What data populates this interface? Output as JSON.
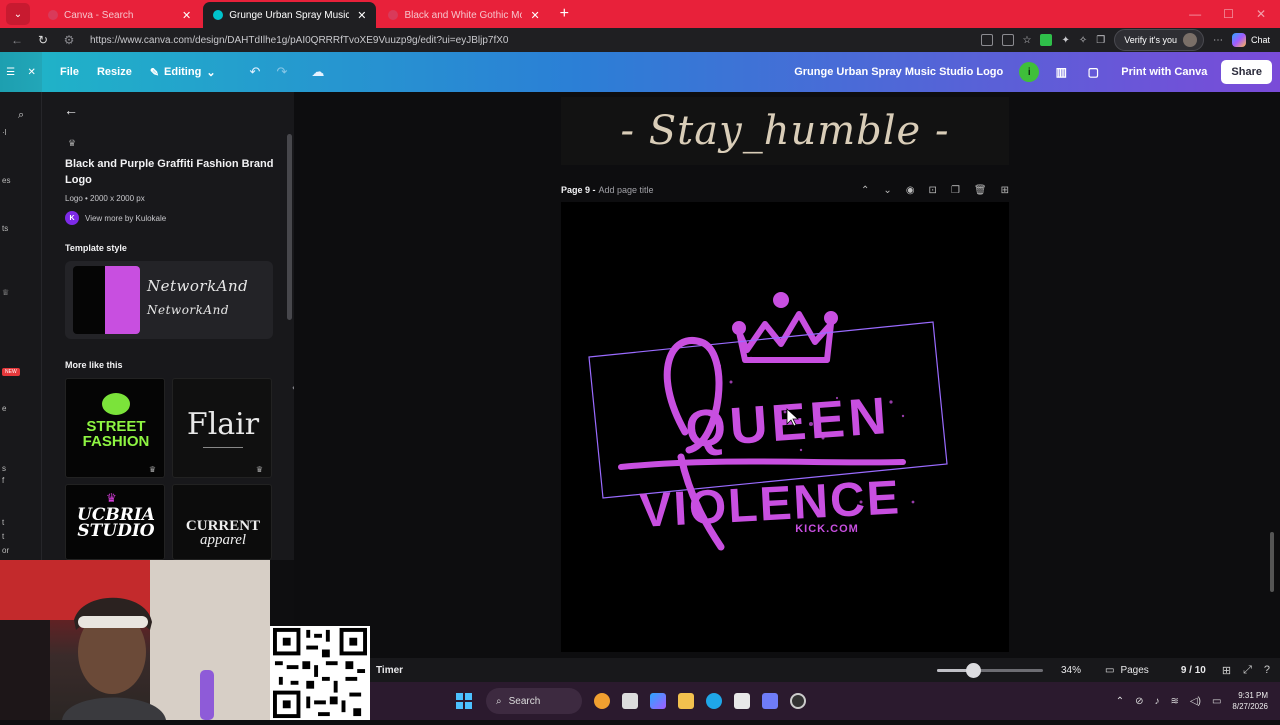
{
  "browser": {
    "tabs": [
      {
        "label": "Canva - Search",
        "active": false
      },
      {
        "label": "Grunge Urban Spray Music Studio",
        "active": true
      },
      {
        "label": "Black and White Gothic Modern",
        "active": false
      }
    ],
    "new_tab_symbol": "+",
    "url": "https://www.canva.com/design/DAHTdIlhe1g/pAI0QRRRfTvoXE9Vuuzp9g/edit?ui=eyJBljp7fX0",
    "verify_label": "Verify it's you",
    "chat_label": "Chat"
  },
  "canva_header": {
    "file": "File",
    "resize": "Resize",
    "editing": "Editing",
    "doc_title": "Grunge Urban Spray Music Studio Logo",
    "info_badge": "i",
    "print": "Print with Canva",
    "share": "Share"
  },
  "rail": {
    "new_badge": "NEW"
  },
  "panel": {
    "template_title": "Black and Purple Graffiti Fashion Brand Logo",
    "template_meta": "Logo • 2000 x 2000 px",
    "creator_initial": "K",
    "creator_link": "View more by Kulokale",
    "template_style_heading": "Template style",
    "style_font_sample_1": "NetworkAnd",
    "style_font_sample_2": "NetworkAnd",
    "more_like_heading": "More like this",
    "thumbs": [
      {
        "line1": "STREET",
        "line2": "FASHION"
      },
      {
        "line1": "Flair",
        "line2": ""
      },
      {
        "line1": "UCBRIA",
        "line2": "STUDIO"
      },
      {
        "line1": "CURRENT",
        "line2": "apparel"
      }
    ]
  },
  "canvas": {
    "prev_page_text": "- Stay_humble -",
    "page_label": "Page 9 -",
    "page_title_placeholder": "Add page title",
    "logo_line1": "QUEEN",
    "logo_line2": "VIOLENCE",
    "logo_sub": "KICK.COM",
    "accent": "#c84fe0"
  },
  "bottom_bar": {
    "timer": "Timer",
    "zoom_fraction": 0.34,
    "zoom": "34%",
    "pages": "Pages",
    "page_count": "9 / 10"
  },
  "taskbar": {
    "search": "Search",
    "time": "9:31 PM",
    "date": "8/27/2026"
  }
}
